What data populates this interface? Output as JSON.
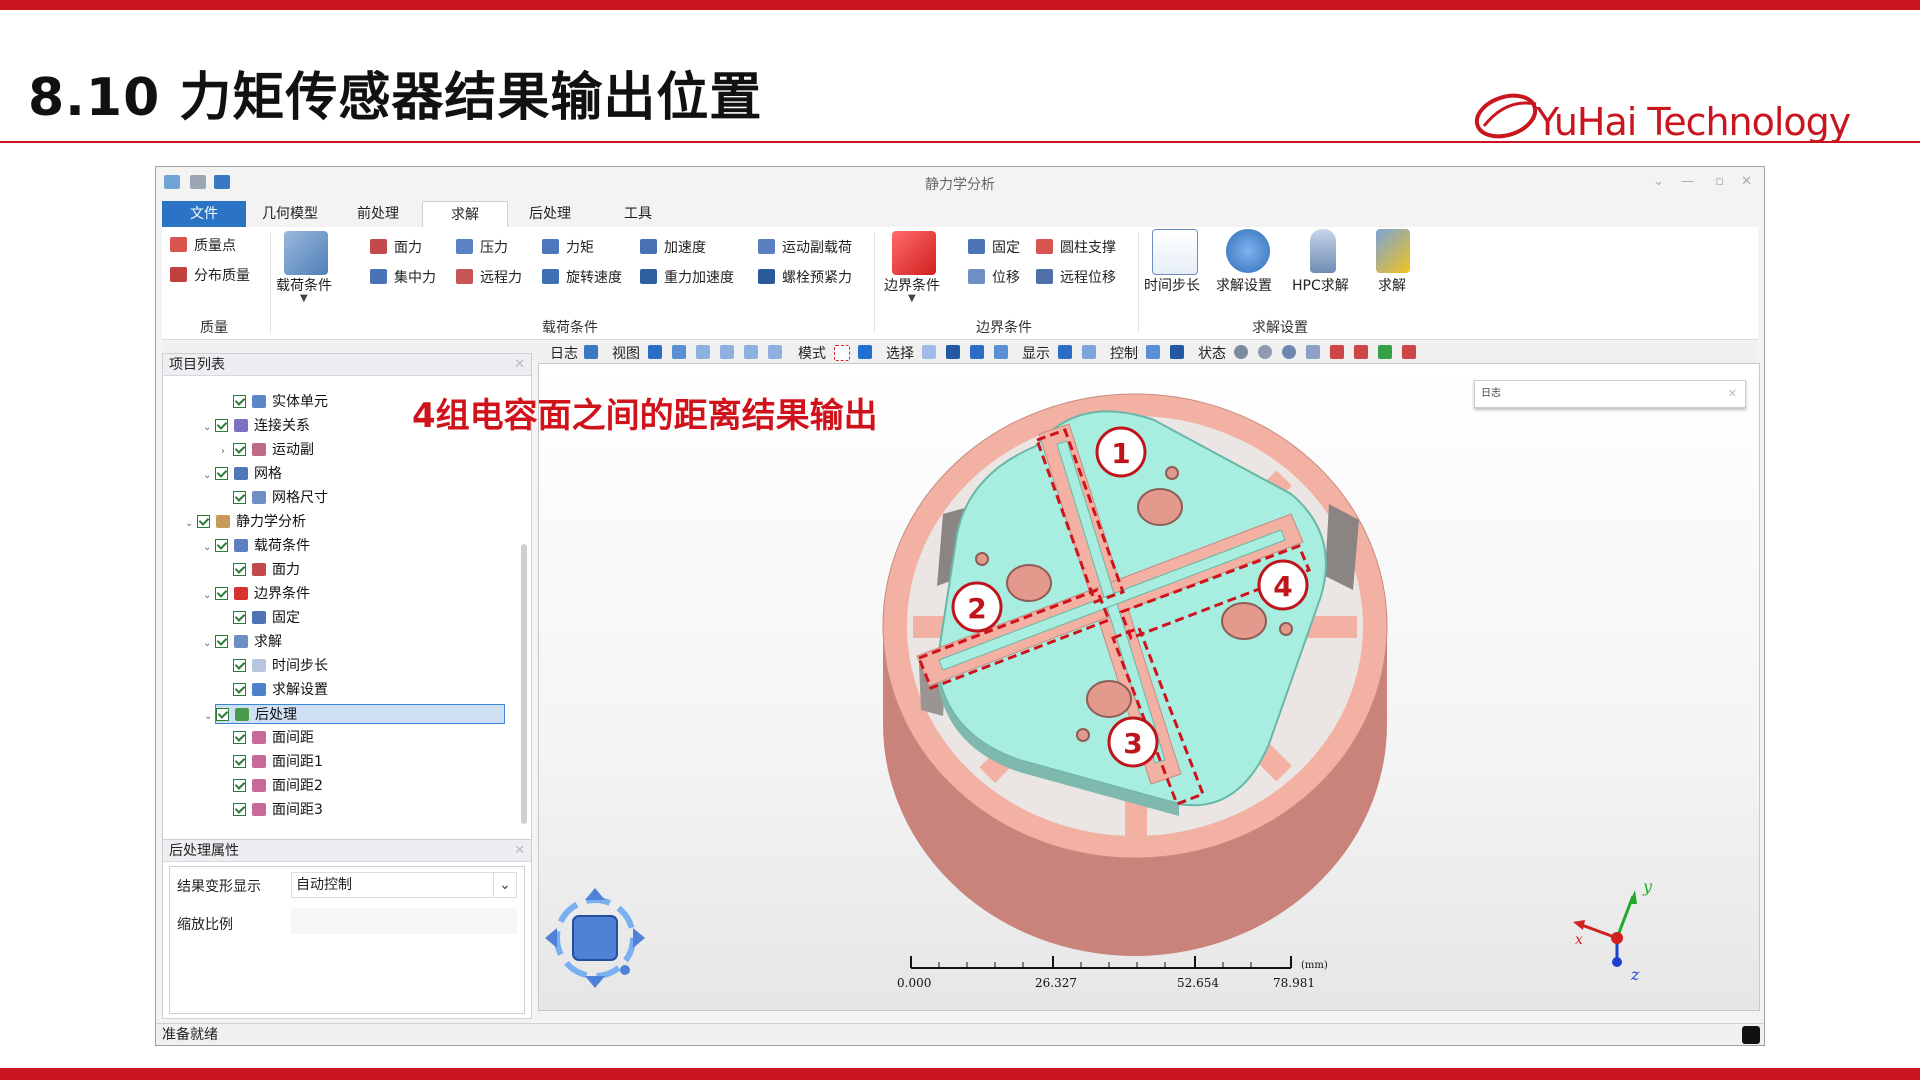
{
  "slide": {
    "title": "8.10 力矩传感器结果输出位置",
    "logo_text": "YuHai Technology",
    "annotation": "4组电容面之间的距离结果输出",
    "accent_color": "#c9151e"
  },
  "app": {
    "window_title": "静力学分析",
    "tabs": [
      "文件",
      "几何模型",
      "前处理",
      "求解",
      "后处理",
      "工具"
    ],
    "active_tab": "求解",
    "ribbon": {
      "mass": {
        "items": [
          "质量点",
          "分布质量"
        ],
        "group": "质量"
      },
      "load": {
        "big": "载荷条件",
        "items": [
          "面力",
          "集中力",
          "压力",
          "远程力",
          "力矩",
          "旋转速度",
          "加速度",
          "重力加速度",
          "运动副载荷",
          "螺栓预紧力"
        ],
        "group": "载荷条件"
      },
      "boundary": {
        "big": "边界条件",
        "items": [
          "固定",
          "位移",
          "圆柱支撑",
          "远程位移"
        ],
        "group": "边界条件"
      },
      "solve": {
        "items": [
          "时间步长",
          "求解设置",
          "HPC求解",
          "求解"
        ],
        "group": "求解设置"
      }
    },
    "toolstrip": [
      "日志",
      "视图",
      "模式",
      "选择",
      "显示",
      "控制",
      "状态"
    ],
    "project_panel": {
      "title": "项目列表",
      "items": [
        "实体单元",
        "连接关系",
        "运动副",
        "网格",
        "网格尺寸",
        "静力学分析",
        "载荷条件",
        "面力",
        "边界条件",
        "固定",
        "求解",
        "时间步长",
        "求解设置",
        "后处理",
        "面间距",
        "面间距1",
        "面间距2",
        "面间距3"
      ]
    },
    "props_panel": {
      "title": "后处理属性",
      "deform_label": "结果变形显示",
      "deform_value": "自动控制",
      "scale_label": "缩放比例"
    },
    "viewport": {
      "log_title": "日志",
      "scale_labels": [
        "0.000",
        "26.327",
        "52.654",
        "78.981"
      ],
      "scale_unit": "(mm)",
      "markers": [
        "1",
        "2",
        "3",
        "4"
      ],
      "axes": [
        "x",
        "y",
        "z"
      ]
    },
    "status": "准备就绪"
  }
}
